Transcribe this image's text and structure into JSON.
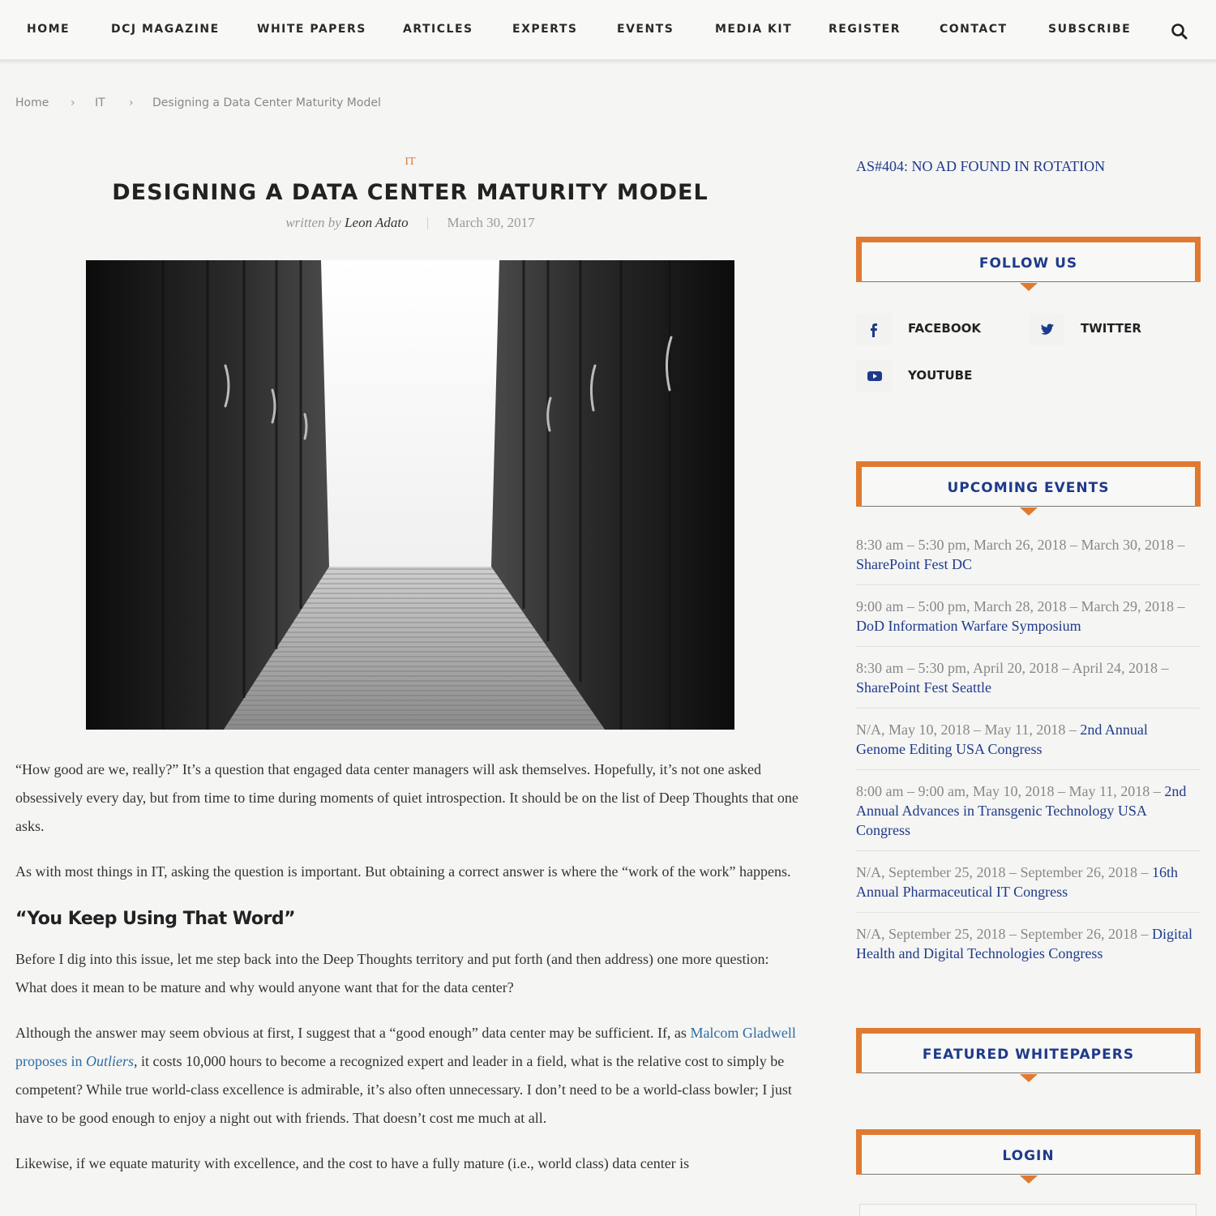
{
  "nav": {
    "items": [
      "HOME",
      "DCJ MAGAZINE",
      "WHITE PAPERS",
      "ARTICLES",
      "EXPERTS",
      "EVENTS",
      "MEDIA KIT",
      "REGISTER",
      "CONTACT",
      "SUBSCRIBE"
    ],
    "search_icon": "search-icon"
  },
  "breadcrumb": {
    "home": "Home",
    "category": "IT",
    "current": "Designing a Data Center Maturity Model",
    "separator": "›"
  },
  "article": {
    "category": "IT",
    "title": "DESIGNING A DATA CENTER MATURITY MODEL",
    "written_by": "written by",
    "author": "Leon Adato",
    "divider": "|",
    "date": "March 30, 2017",
    "image_alt": "Data center server rack aisle (black and white)",
    "paragraphs": {
      "p1": "“How good are we, really?” It’s a question that engaged data center managers will ask themselves. Hopefully, it’s not one asked obsessively every day, but from time to time during moments of quiet introspection. It should be on the list of Deep Thoughts that one asks.",
      "p2": "As with most things in IT, asking the question is important. But obtaining a correct answer is where the “work of the work” happens.",
      "h2": "“You Keep Using That Word”",
      "p3": "Before I dig into this issue, let me step back into the Deep Thoughts territory and put forth (and then address) one more question: What does it mean to be mature and why would anyone want that for the data center?",
      "p4_before": "Although the answer may seem obvious at first, I suggest that a “good enough” data center may be sufficient. If, as ",
      "p4_link": "Malcom Gladwell proposes in ",
      "p4_link_em": "Outliers",
      "p4_after": ", it costs 10,000 hours to become a recognized expert and leader in a field, what is the relative cost to simply be competent? While true world-class excellence is admirable, it’s also often unnecessary. I don’t need to be a world-class bowler; I just have to be good enough to enjoy a night out with friends. That doesn’t cost me much at all.",
      "p5": "Likewise, if we equate maturity with excellence, and the cost to have a fully mature (i.e., world class) data center is"
    }
  },
  "sidebar": {
    "ad_text": "AS#404: NO AD FOUND IN ROTATION",
    "follow_title": "FOLLOW US",
    "social": [
      {
        "label": "FACEBOOK",
        "icon": "facebook-icon"
      },
      {
        "label": "TWITTER",
        "icon": "twitter-icon"
      },
      {
        "label": "YOUTUBE",
        "icon": "youtube-icon"
      }
    ],
    "events_title": "UPCOMING EVENTS",
    "events": [
      {
        "when": "8:30 am – 5:30 pm, March 26, 2018 – March 30, 2018 – ",
        "name": "SharePoint Fest DC"
      },
      {
        "when": "9:00 am – 5:00 pm, March 28, 2018 – March 29, 2018 – ",
        "name": "DoD Information Warfare Symposium"
      },
      {
        "when": "8:30 am – 5:30 pm, April 20, 2018 – April 24, 2018 – ",
        "name": "SharePoint Fest Seattle"
      },
      {
        "when": "N/A, May 10, 2018 – May 11, 2018 – ",
        "name": "2nd Annual Genome Editing USA Congress"
      },
      {
        "when": "8:00 am – 9:00 am, May 10, 2018 – May 11, 2018 – ",
        "name": "2nd Annual Advances in Transgenic Technology USA Congress"
      },
      {
        "when": "N/A, September 25, 2018 – September 26, 2018 – ",
        "name": "16th Annual Pharmaceutical IT Congress"
      },
      {
        "when": "N/A, September 25, 2018 – September 26, 2018 – ",
        "name": "Digital Health and Digital Technologies Congress"
      }
    ],
    "whitepapers_title": "FEATURED WHITEPAPERS",
    "login_title": "LOGIN"
  },
  "colors": {
    "accent_orange": "#e07a30",
    "link_navy": "#1e3a8a",
    "link_blue": "#2e6da4",
    "category_orange": "#d9773a"
  }
}
